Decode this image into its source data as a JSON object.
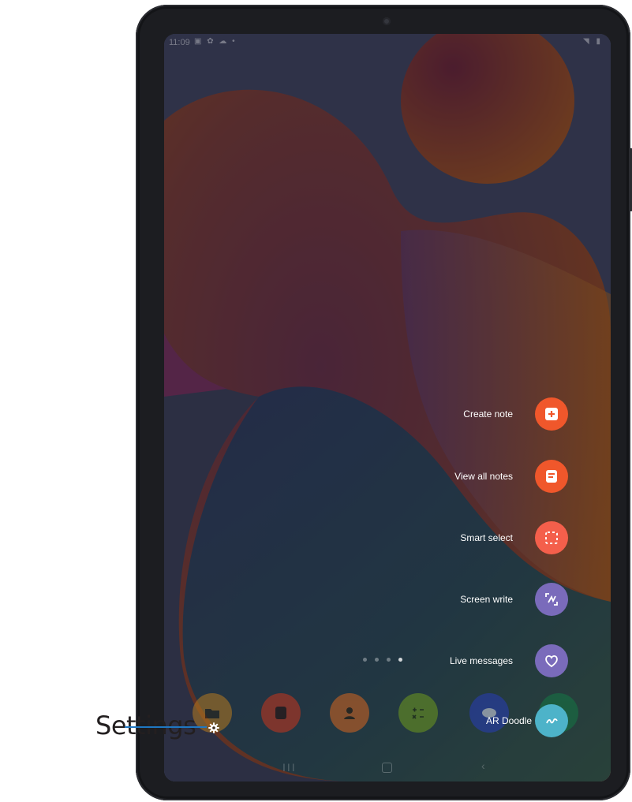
{
  "device": {
    "statusbar": {
      "time": "11:09",
      "left_icons": "▣ ✿ ☁ •",
      "right_icons": "◥ ▮"
    }
  },
  "air_command": {
    "items": [
      {
        "label": "Create note",
        "icon": "create-note-icon",
        "color": "#f0572b"
      },
      {
        "label": "View all notes",
        "icon": "view-all-notes-icon",
        "color": "#f0572b"
      },
      {
        "label": "Smart select",
        "icon": "smart-select-icon",
        "color": "#f45f4b"
      },
      {
        "label": "Screen write",
        "icon": "screen-write-icon",
        "color": "#7a6bbb"
      },
      {
        "label": "Live messages",
        "icon": "live-messages-icon",
        "color": "#7a6bbb"
      },
      {
        "label": "AR Doodle",
        "icon": "ar-doodle-icon",
        "color": "#4db3c9"
      }
    ]
  },
  "dock": {
    "apps": [
      {
        "name": "folder",
        "color": "#b67a1f"
      },
      {
        "name": "notes",
        "color": "#c9351c"
      },
      {
        "name": "contacts",
        "color": "#d7661f"
      },
      {
        "name": "calculator",
        "color": "#6f9a1e"
      },
      {
        "name": "galaxy-store",
        "color": "#283db8"
      },
      {
        "name": "video",
        "color": "#147845"
      }
    ],
    "settings_badge": "gear-icon"
  },
  "callout": {
    "label": "Settings",
    "color": "#1f77c2"
  },
  "colors": {
    "bezel": "#1c1d21",
    "accent_orange": "#f0572b",
    "accent_purple": "#7a6bbb"
  }
}
